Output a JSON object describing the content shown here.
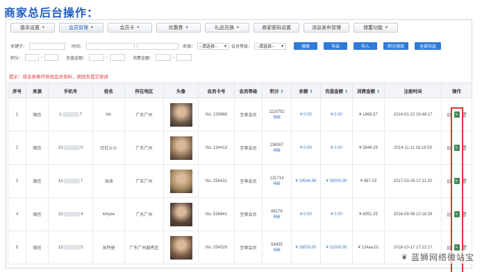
{
  "page_title": "商家总后台操作：",
  "nav": [
    {
      "label": "基本设置",
      "dropdown": true
    },
    {
      "label": "会员管理",
      "dropdown": true,
      "active": true
    },
    {
      "label": "会员卡",
      "dropdown": true
    },
    {
      "label": "优惠券",
      "dropdown": true
    },
    {
      "label": "礼品兑换",
      "dropdown": true
    },
    {
      "label": "商家密码设置",
      "dropdown": false
    },
    {
      "label": "消息发布管理",
      "dropdown": false
    },
    {
      "label": "储蓄功能",
      "dropdown": true
    }
  ],
  "filters": {
    "keyword_label": "关键字：",
    "time_label": "时间：",
    "source_label": "来源：",
    "source_value": "--请选择--",
    "level_label": "会员等级：",
    "level_value": "--请选择--",
    "points_label": "积分：",
    "recharge_label": "充值金额：",
    "consume_label": "消费金额：",
    "range_sep": "-",
    "buttons": [
      "搜索",
      "导出",
      "导入",
      "积分修改",
      "全部勾选"
    ]
  },
  "hint": "提示：双击表格可修改会员资料，按回车提交修改",
  "table": {
    "headers": [
      "序号",
      "来源",
      "手机号",
      "姓名",
      "所在地区",
      "头像",
      "会员卡号",
      "会员等级",
      "积分",
      "余额",
      "充值金额",
      "消费金额",
      "注册时间",
      "操作"
    ],
    "rows": [
      {
        "no": "1",
        "source": "微信",
        "phone_start": "1",
        "phone_end": "7",
        "name": "kin",
        "region": "广东广州",
        "card": "No. 130868",
        "level": "至尊会员",
        "points": "1118792",
        "points_sub": "明细",
        "balance": "¥ 0.00",
        "recharge": "¥ 0.00",
        "consume": "¥ 1866.57",
        "reg_time": "2014-01-22 16:48:17",
        "avatar_color": "#6b5a4a"
      },
      {
        "no": "2",
        "source": "微信",
        "phone_start": "13",
        "phone_end": "0",
        "name": "红红火火",
        "region": "广东广州",
        "card": "No. 134413",
        "level": "至尊会员",
        "points": "236907",
        "points_sub": "明细",
        "balance": "¥ 0.00",
        "recharge": "¥ 0.00",
        "consume": "¥ 3846.29",
        "reg_time": "2014-11-11 16:18:59",
        "avatar_color": "#8a6e52"
      },
      {
        "no": "3",
        "source": "微信",
        "phone_start": "13",
        "phone_end": "7",
        "name": "涛涛",
        "region": "广东广州",
        "card": "No. 258431",
        "level": "至尊会员",
        "points": "131714",
        "points_sub": "明细",
        "balance": "¥ 19546.56",
        "recharge": "¥ 30000.00",
        "consume": "¥ 887.03",
        "reg_time": "2017-03-26 17:11:20",
        "avatar_color": "#a2875e"
      },
      {
        "no": "4",
        "source": "微信",
        "phone_start": "13",
        "phone_end": "4",
        "name": "kinyee",
        "region": "广东广州",
        "card": "No. 536841",
        "level": "至尊会员",
        "points": "88176",
        "points_sub": "明细",
        "balance": "¥ 0.00",
        "recharge": "¥ 0.00",
        "consume": "¥ 8951.25",
        "reg_time": "2016-09-08 10:18:28",
        "avatar_color": "#5a463a"
      },
      {
        "no": "5",
        "source": "微信",
        "phone_start": "13",
        "phone_end": "5",
        "name": "吴特曼",
        "region": "广东广州越秀区",
        "card": "No. 254329",
        "level": "至尊会员",
        "points": "54955",
        "points_sub": "明细",
        "balance": "¥ 16533.00",
        "recharge": "¥ 21000.00",
        "consume": "¥ 124aa.01",
        "reg_time": "2016-10-17 17:22:1?",
        "avatar_color": "#7a5b45"
      }
    ]
  },
  "watermark": "蓝狮网络微站宝",
  "colors": {
    "accent": "#2f7bd6",
    "title": "#1f5fbf",
    "hint": "#d93838",
    "highlight_box": "#e03030"
  }
}
